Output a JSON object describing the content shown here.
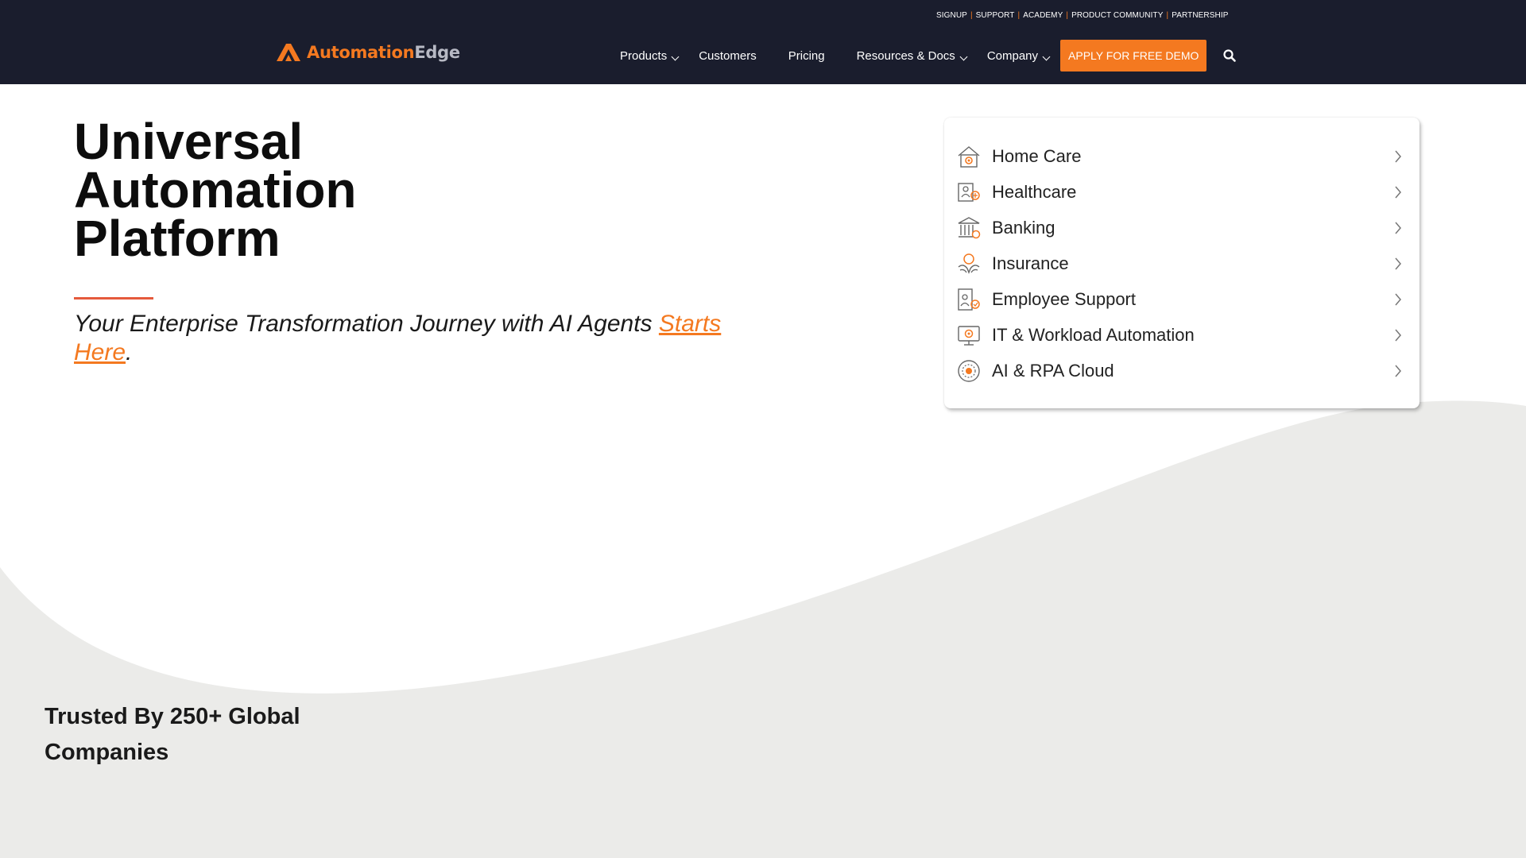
{
  "header": {
    "utility_links": [
      "SIGNUP",
      "SUPPORT",
      "ACADEMY",
      "PRODUCT COMMUNITY",
      "PARTNERSHIP"
    ],
    "logo": {
      "part1": "Automation",
      "part2": "Edge"
    },
    "nav": [
      {
        "label": "Products",
        "has_dropdown": true
      },
      {
        "label": "Customers",
        "has_dropdown": false
      },
      {
        "label": "Pricing",
        "has_dropdown": false
      },
      {
        "label": "Resources & Docs",
        "has_dropdown": true
      },
      {
        "label": "Company",
        "has_dropdown": true
      }
    ],
    "cta_label": "APPLY FOR FREE DEMO",
    "search_icon": "search-icon"
  },
  "hero": {
    "title_lines": [
      "Universal",
      "Automation",
      "Platform"
    ],
    "subtitle_text": "Your Enterprise Transformation Journey with AI Agents ",
    "subtitle_link": "Starts Here",
    "subtitle_end": "."
  },
  "industries": [
    {
      "label": "Home Care",
      "icon": "home-care-icon"
    },
    {
      "label": "Healthcare",
      "icon": "healthcare-icon"
    },
    {
      "label": "Banking",
      "icon": "bank-icon"
    },
    {
      "label": "Insurance",
      "icon": "insurance-icon"
    },
    {
      "label": "Employee Support",
      "icon": "employee-support-icon"
    },
    {
      "label": "IT & Workload Automation",
      "icon": "it-automation-icon"
    },
    {
      "label": "AI & RPA Cloud",
      "icon": "ai-cloud-icon"
    }
  ],
  "trusted": {
    "line1": "Trusted By 250+ Global",
    "line2": "Companies"
  },
  "colors": {
    "header_bg": "#1a1d2d",
    "accent": "#f47920",
    "rule": "#e55a3c",
    "wave": "#ebebe9"
  }
}
